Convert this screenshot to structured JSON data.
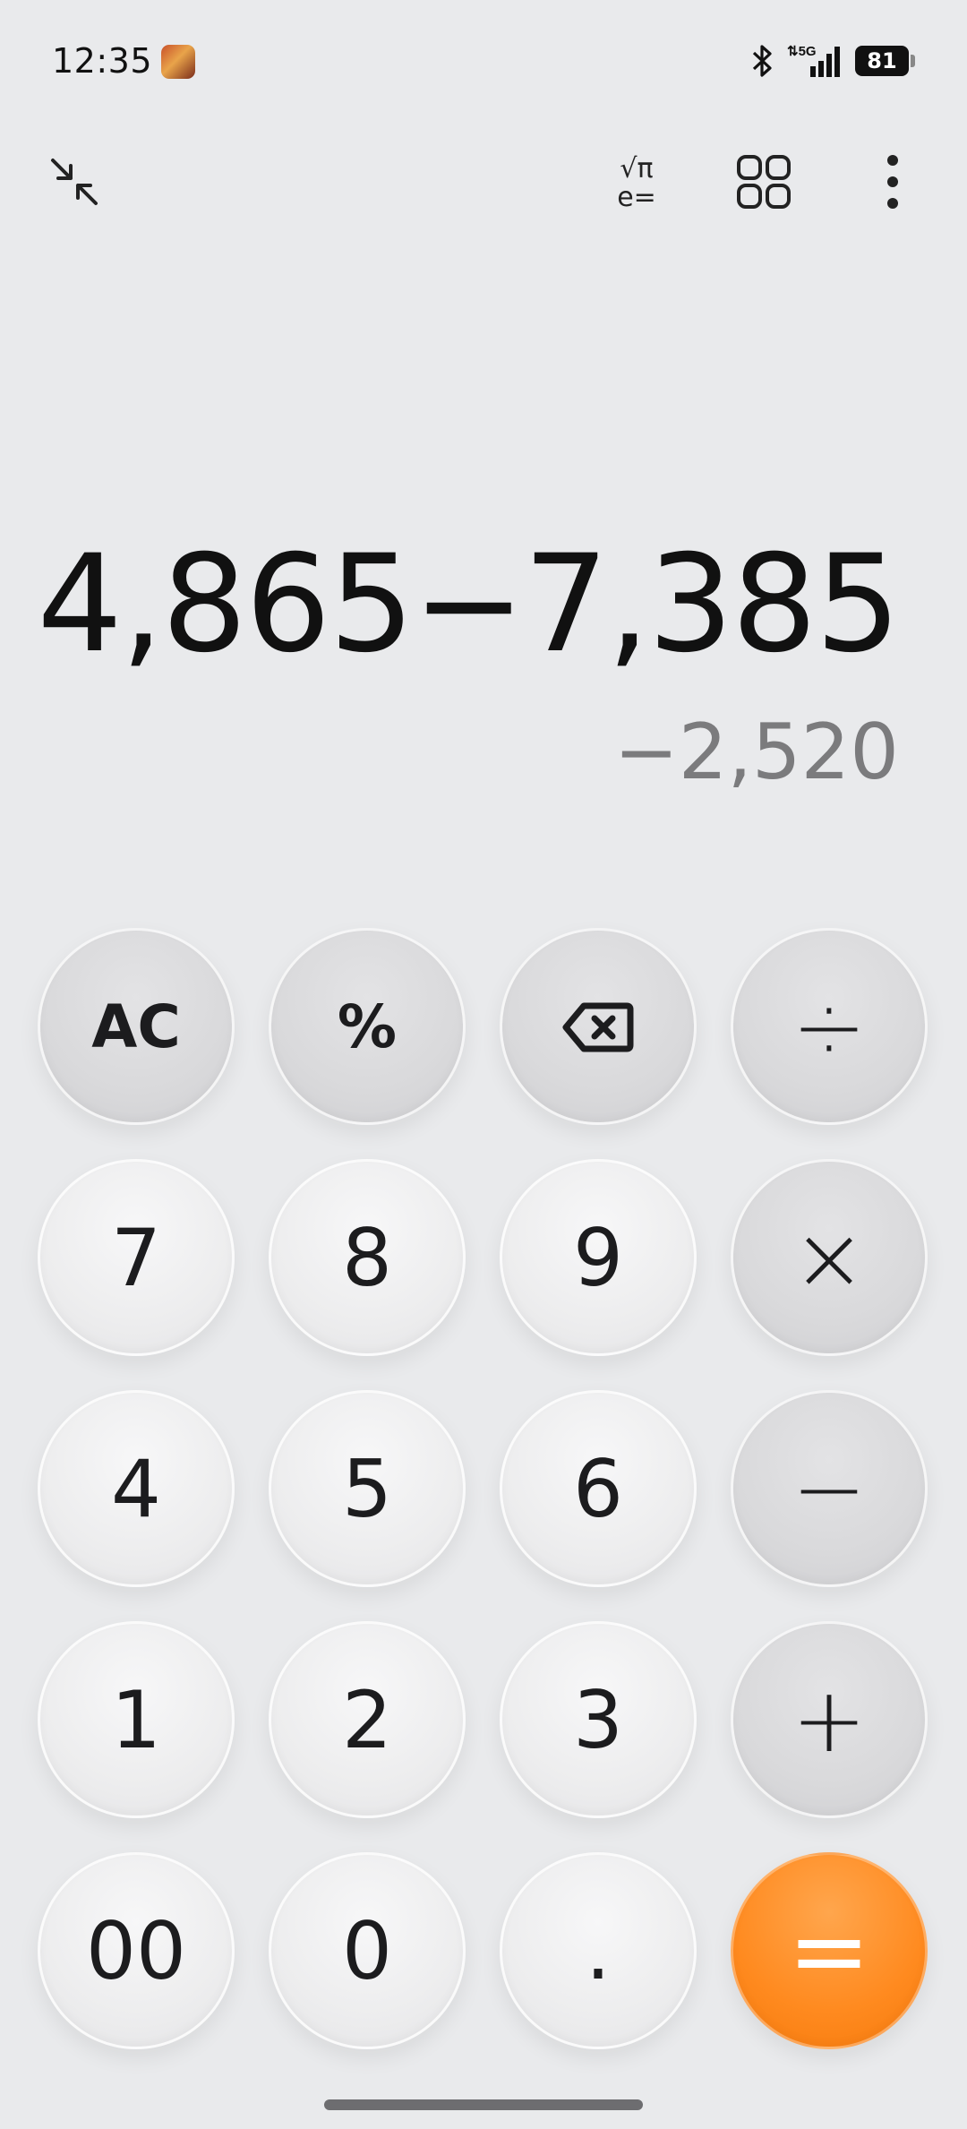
{
  "status_bar": {
    "time": "12:35",
    "network": "5G",
    "battery": "81"
  },
  "toolbar": {
    "icons": [
      "collapse-icon",
      "scientific-mode-icon",
      "converter-grid-icon",
      "more-options-icon"
    ],
    "scientific_line1": "√π",
    "scientific_line2": "e="
  },
  "display": {
    "expression": "4,865−7,385",
    "result": "−2,520"
  },
  "keys": {
    "clear": "AC",
    "percent": "%",
    "backspace_icon": "backspace-icon",
    "divide": "÷",
    "seven": "7",
    "eight": "8",
    "nine": "9",
    "multiply": "×",
    "four": "4",
    "five": "5",
    "six": "6",
    "minus": "−",
    "one": "1",
    "two": "2",
    "three": "3",
    "plus": "+",
    "double_zero": "00",
    "zero": "0",
    "decimal": ".",
    "equals": "="
  },
  "colors": {
    "background": "#e9eaec",
    "equals_accent": "#ff8a1f",
    "result_text": "#7b7b7d"
  }
}
